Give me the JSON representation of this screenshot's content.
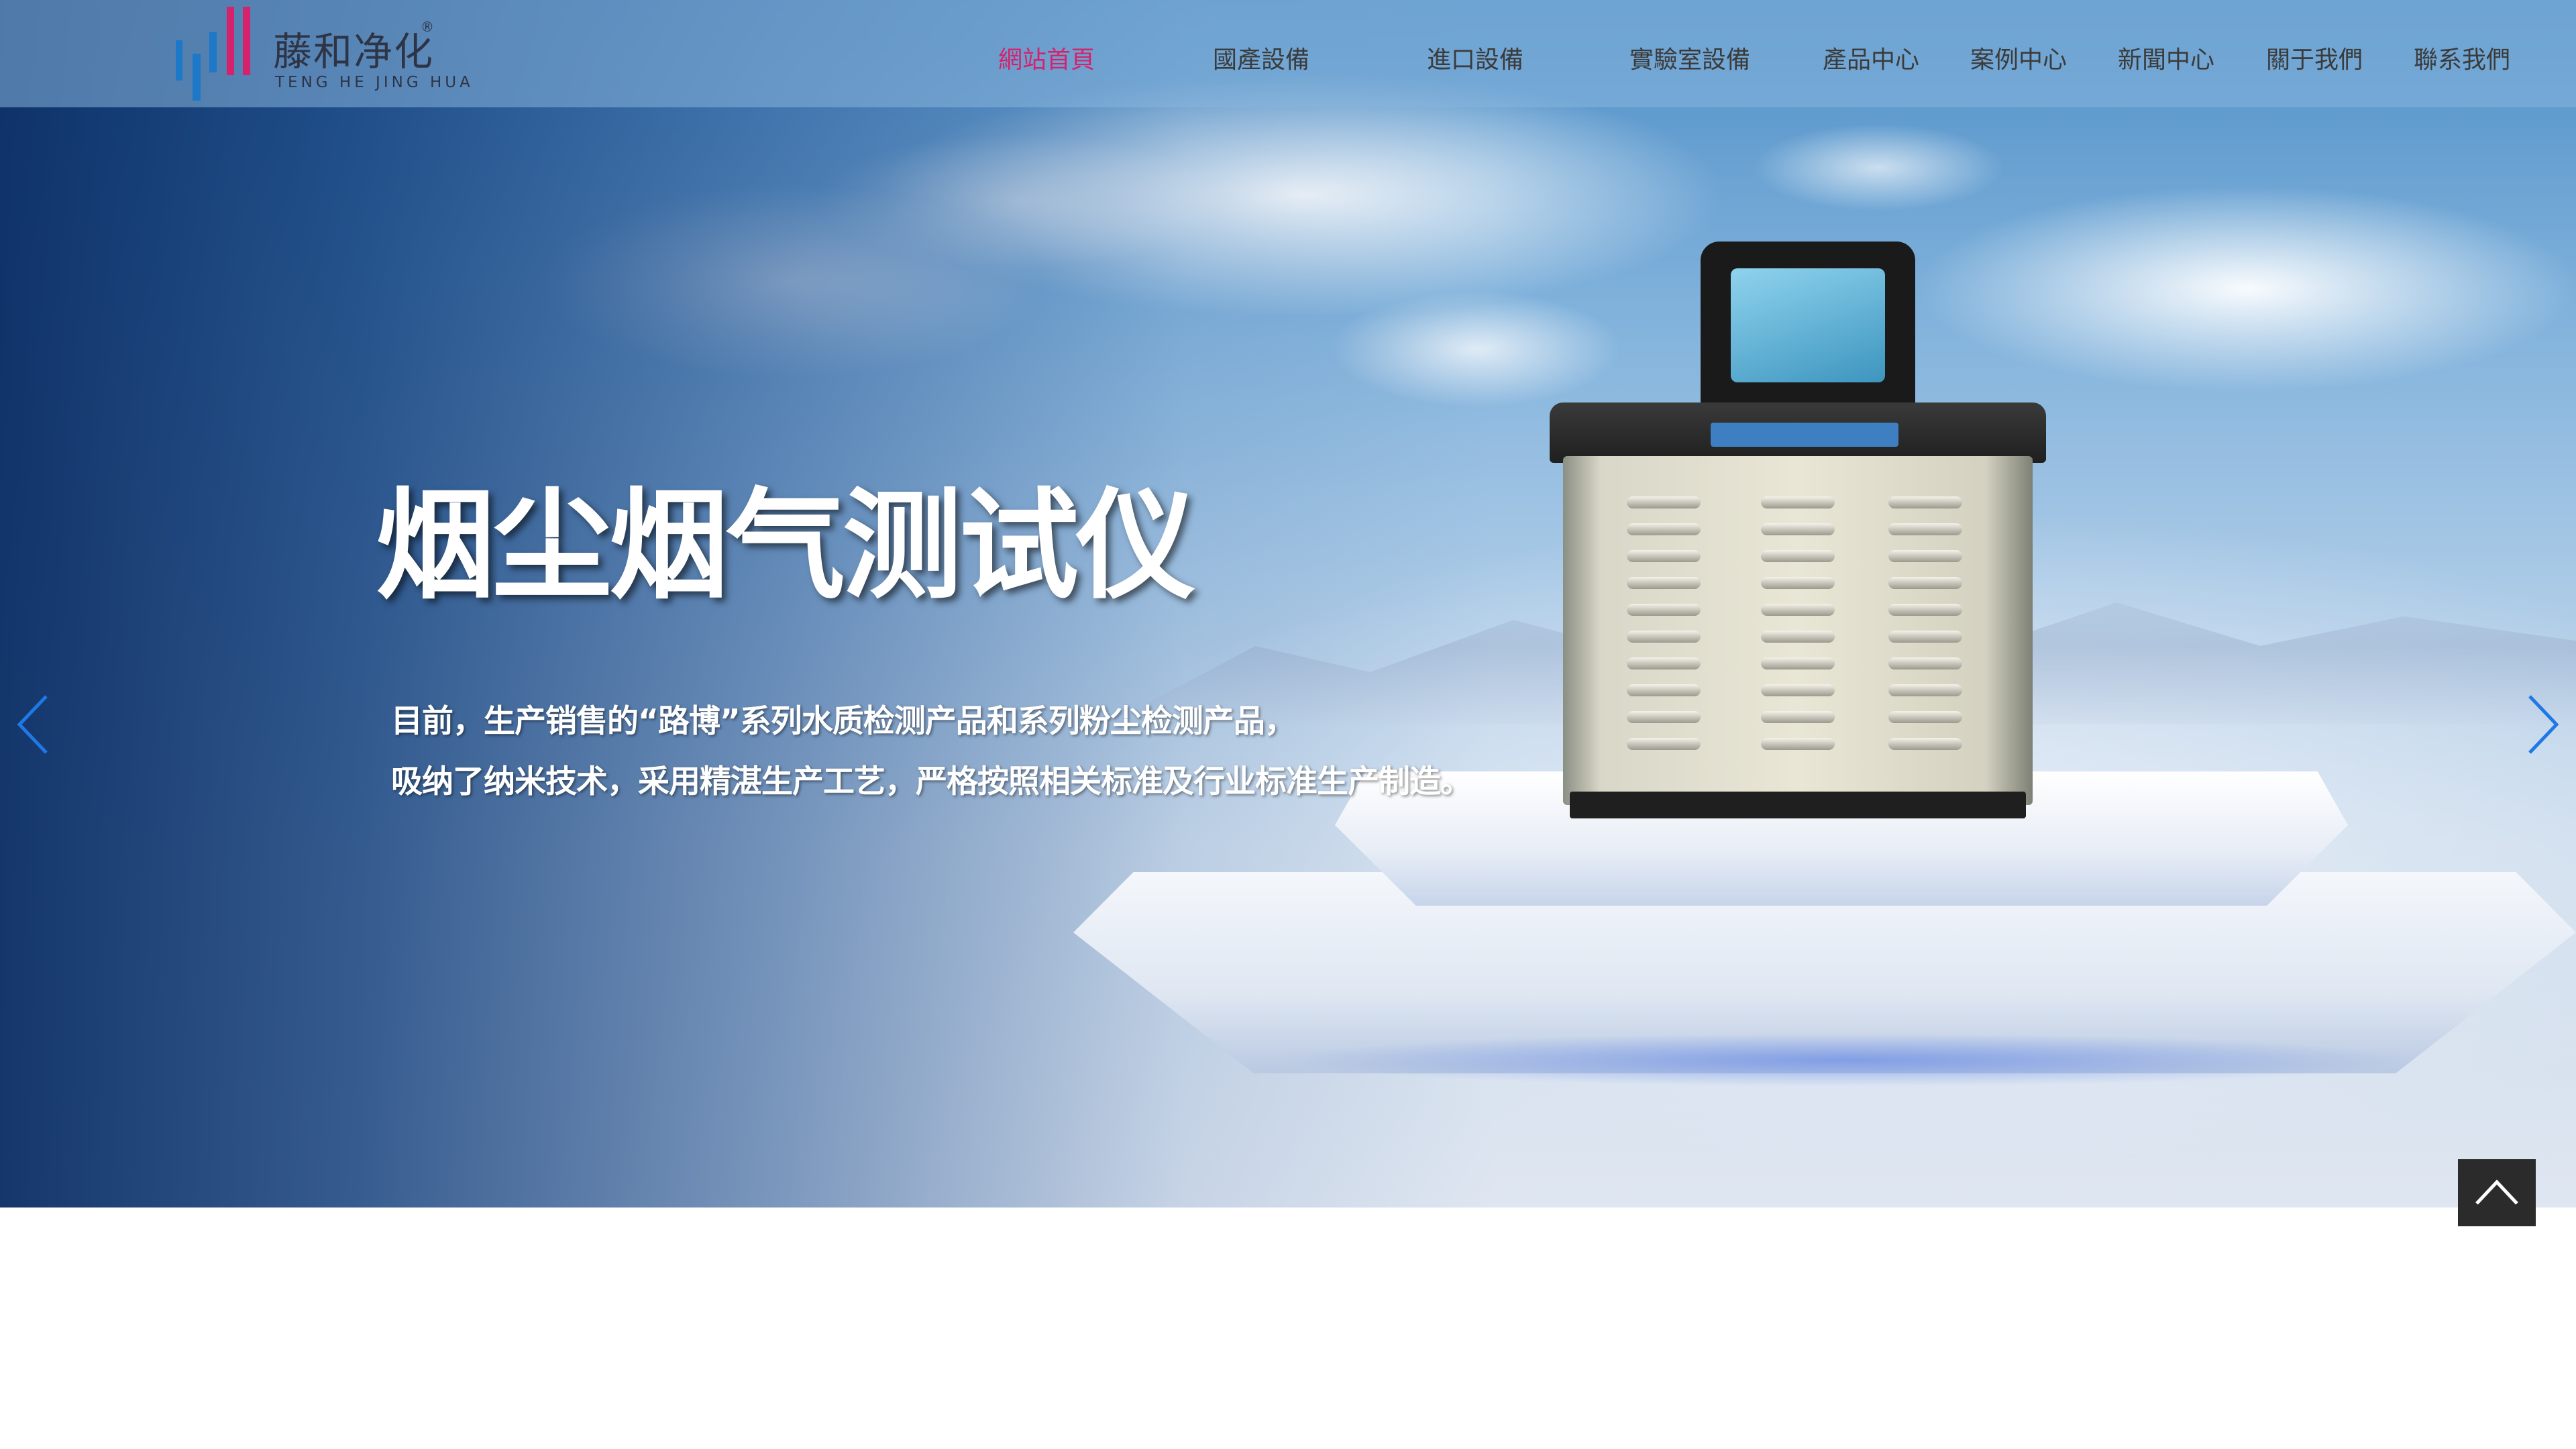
{
  "brand": {
    "name_cn": "藤和净化",
    "name_en": "TENG HE JING HUA",
    "registered_mark": "®",
    "bar_blue": "#1e78c8",
    "bar_red": "#d6216d"
  },
  "nav": {
    "active_color": "#d6216d",
    "items": [
      {
        "label": "網站首頁",
        "active": true
      },
      {
        "label": "國產設備",
        "active": false
      },
      {
        "label": "進口設備",
        "active": false
      },
      {
        "label": "實驗室設備",
        "active": false
      },
      {
        "label": "產品中心",
        "active": false
      },
      {
        "label": "案例中心",
        "active": false
      },
      {
        "label": "新聞中心",
        "active": false
      },
      {
        "label": "關于我們",
        "active": false
      },
      {
        "label": "聯系我們",
        "active": false
      }
    ]
  },
  "banner": {
    "title": "烟尘烟气测试仪",
    "subtitle_line1": "目前，生产销售的“路博”系列水质检测产品和系列粉尘检测产品，",
    "subtitle_line2": "吸纳了纳米技术，采用精湛生产工艺，严格按照相关标准及行业标准生产制造。",
    "arrow_color": "#1e78e6",
    "prev_icon": "chevron-left-icon",
    "next_icon": "chevron-right-icon"
  },
  "back_to_top": {
    "icon": "chevron-up-icon"
  }
}
